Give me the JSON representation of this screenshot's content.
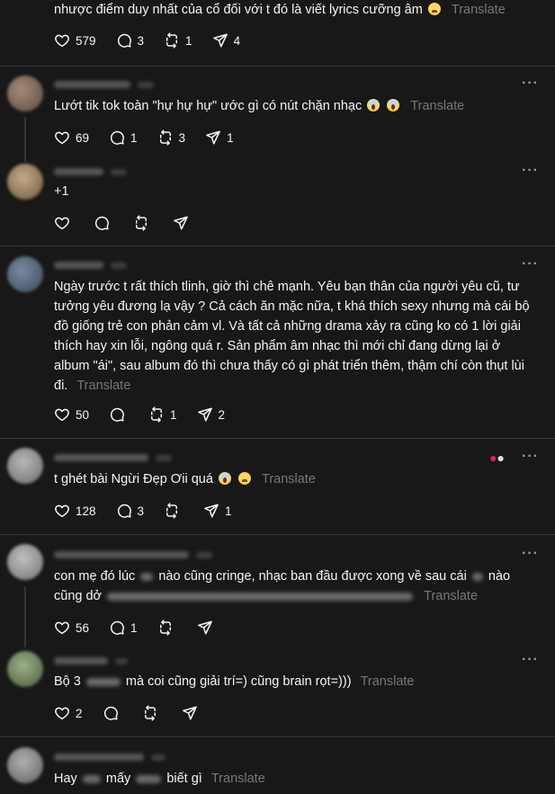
{
  "translate_label": "Translate",
  "posts": [
    {
      "text": "nhược điểm duy nhất của cổ đối với t đó là viết lyrics cưỡng âm",
      "likes": "579",
      "replies": "3",
      "reposts": "1",
      "shares": "4"
    },
    {
      "text": "Lướt tik tok toàn \"hự hự hự\" ước gì có nút chặn nhạc",
      "likes": "69",
      "replies": "1",
      "reposts": "3",
      "shares": "1"
    },
    {
      "text": "+1",
      "likes": "",
      "replies": "",
      "reposts": "",
      "shares": ""
    },
    {
      "text": "Ngày trước t rất thích tlinh, giờ thì chê mạnh. Yêu bạn thân của người yêu cũ, tư tưởng yêu đương lạ vậy ? Cả cách ăn mặc nữa, t khá thích sexy nhưng mà cái bộ đồ giống trẻ con phản cảm vl. Và tất cả những drama xảy ra cũng ko có 1 lời giải thích hay xin lỗi, ngông quá r. Sản phẩm âm nhạc thì mới chỉ đang dừng lại ở album \"ái\", sau album đó thì chưa thấy có gì phát triển thêm, thậm chí còn thụt lùi đi.",
      "likes": "50",
      "replies": "",
      "reposts": "1",
      "shares": "2"
    },
    {
      "text": "t ghét bài Ngừi Đẹp Ơii quá",
      "likes": "128",
      "replies": "3",
      "reposts": "",
      "shares": "1"
    },
    {
      "text_a": "con mẹ đó lúc",
      "text_b": "nào cũng cringe, nhạc ban đầu được xong về sau cái",
      "text_c": "nào cũng",
      "text_d": "dở",
      "likes": "56",
      "replies": "1",
      "reposts": "",
      "shares": ""
    },
    {
      "text_a": "Bộ 3",
      "text_b": "mà coi cũng giải trí=) cũng brain rọt=)))",
      "likes": "2",
      "replies": "",
      "reposts": "",
      "shares": ""
    },
    {
      "text_a": "Hay",
      "text_b": "mấy",
      "text_c": "biết gì"
    }
  ],
  "icons": [
    "heart-icon",
    "comment-icon",
    "repost-icon",
    "share-icon",
    "more-icon"
  ]
}
